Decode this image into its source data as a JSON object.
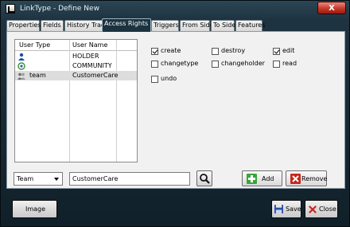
{
  "window": {
    "title": "LinkType - Define New",
    "close_label": "X"
  },
  "tabs": [
    {
      "label": "Properties"
    },
    {
      "label": "Fields"
    },
    {
      "label": "History Trace"
    },
    {
      "label": "Access Rights",
      "active": true
    },
    {
      "label": "Triggers"
    },
    {
      "label": "From Side"
    },
    {
      "label": "To Side"
    },
    {
      "label": "Features"
    }
  ],
  "user_table": {
    "headers": {
      "type": "User Type",
      "name": "User Name"
    },
    "rows": [
      {
        "type": "",
        "name": "HOLDER",
        "icon": "user-icon"
      },
      {
        "type": "",
        "name": "COMMUNITY",
        "icon": "community-icon"
      },
      {
        "type": "team",
        "name": "CustomerCare",
        "icon": "team-icon",
        "selected": true
      }
    ]
  },
  "rights": [
    {
      "label": "create",
      "checked": true
    },
    {
      "label": "destroy",
      "checked": false
    },
    {
      "label": "edit",
      "checked": true
    },
    {
      "label": "changetype",
      "checked": false
    },
    {
      "label": "changeholder",
      "checked": false
    },
    {
      "label": "read",
      "checked": false
    },
    {
      "label": "undo",
      "checked": false
    }
  ],
  "controls": {
    "type_select": "Team",
    "name_value": "CustomerCare",
    "add_label": "Add",
    "remove_label": "Remove"
  },
  "footer": {
    "image_label": "Image",
    "save_label": "Save",
    "close_label": "Close"
  },
  "colors": {
    "accent": "#1c3240",
    "add_green": "#3aa53a",
    "remove_red": "#c8251b"
  }
}
